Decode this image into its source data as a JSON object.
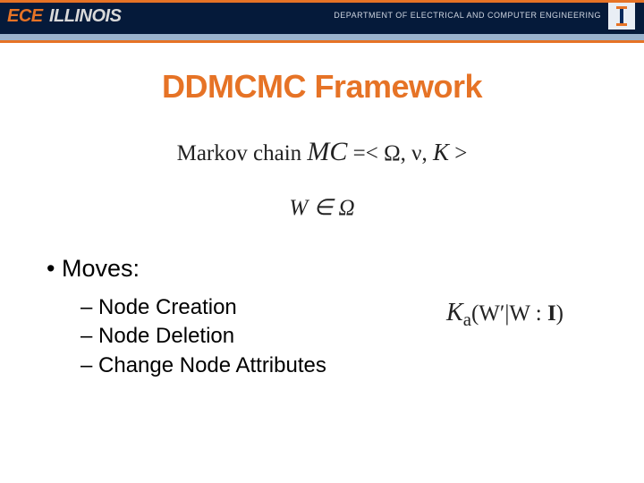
{
  "header": {
    "ece": "ECE",
    "illinois": "ILLINOIS",
    "dept": "DEPARTMENT OF ELECTRICAL AND COMPUTER ENGINEERING"
  },
  "title": "DDMCMC Framework",
  "equations": {
    "markov_label": "Markov chain ",
    "mc_symbol": "MC",
    "mc_eq": " =< Ω, ν, ",
    "mc_k": "K",
    "mc_close": " >",
    "w_in": "W ∈ Ω",
    "ka": "K",
    "ka_sub": "a",
    "ka_args_open": "(W′|W : ",
    "ka_I": "I",
    "ka_args_close": ")"
  },
  "bullets": {
    "moves": "Moves:",
    "items": [
      "Node Creation",
      "Node Deletion",
      "Change Node Attributes"
    ]
  }
}
